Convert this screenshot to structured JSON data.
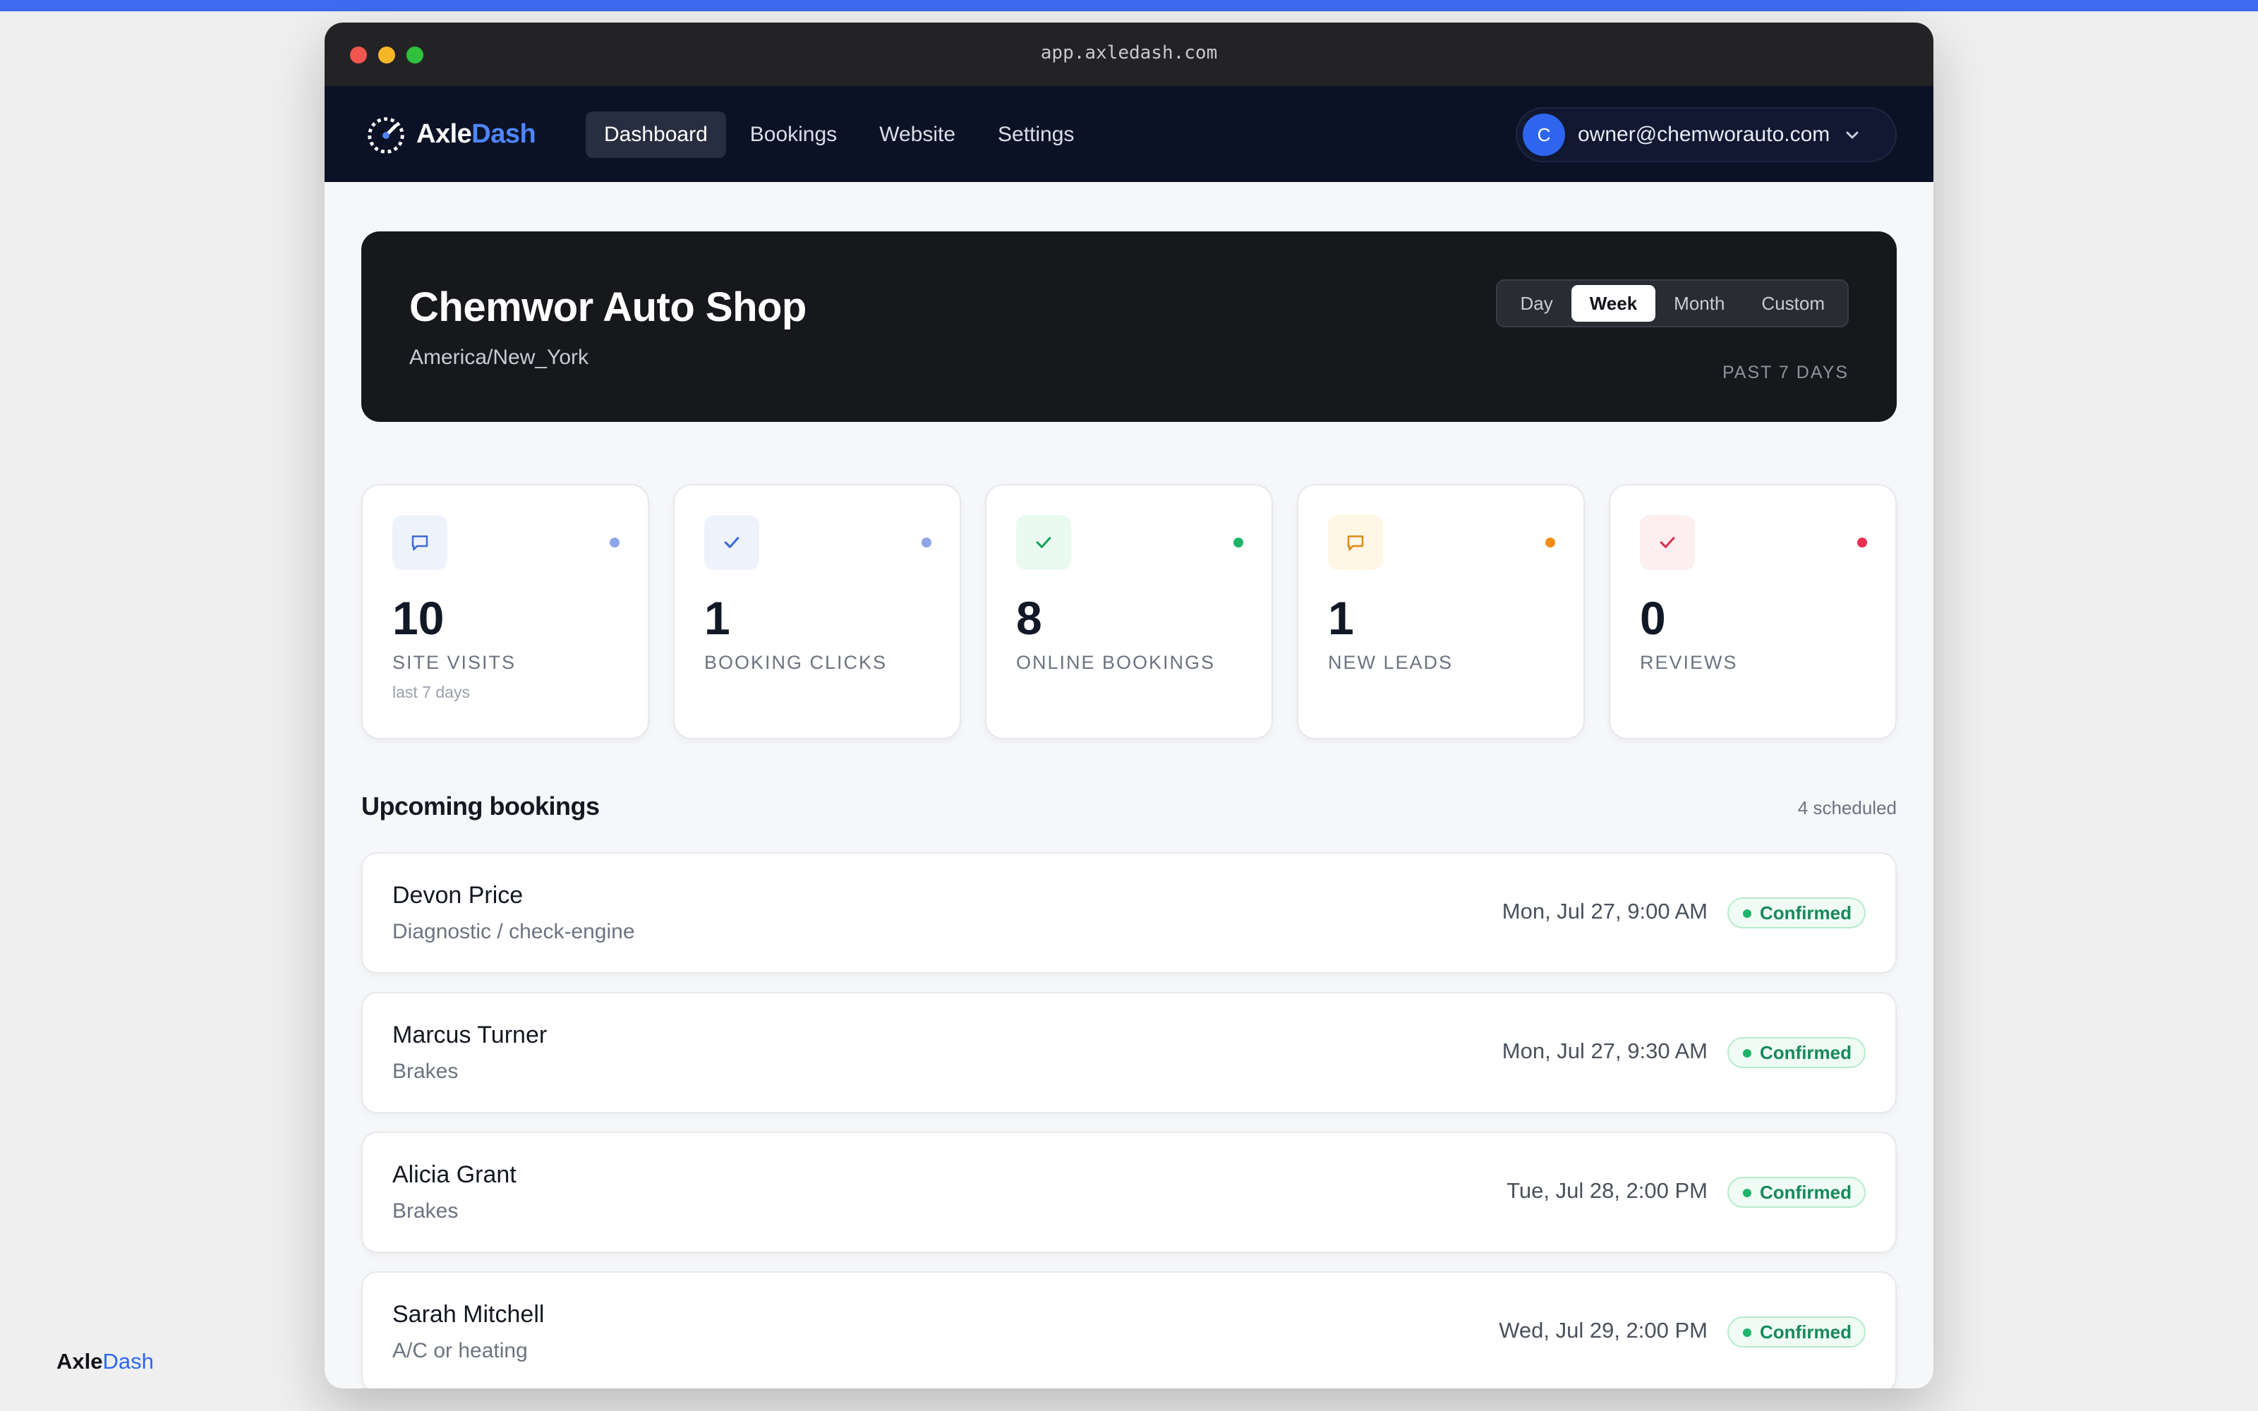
{
  "browser": {
    "url": "app.axledash.com"
  },
  "brand": {
    "name_prefix": "Axle",
    "name_suffix": "Dash"
  },
  "nav": {
    "links": [
      {
        "label": "Dashboard",
        "active": true
      },
      {
        "label": "Bookings"
      },
      {
        "label": "Website"
      },
      {
        "label": "Settings"
      }
    ]
  },
  "account": {
    "initial": "C",
    "email": "owner@chemworauto.com"
  },
  "shop": {
    "name": "Chemwor Auto Shop",
    "timezone": "America/New_York"
  },
  "range": {
    "options": [
      "Day",
      "Week",
      "Month",
      "Custom"
    ],
    "selected": "Week",
    "caption": "PAST 7 DAYS"
  },
  "stats": [
    {
      "value": "10",
      "label": "SITE VISITS",
      "sub": "last 7 days",
      "icon": "chat-icon",
      "color": "#3d6bd6",
      "bg": "#eef2fb",
      "dot": "#8ea5e8"
    },
    {
      "value": "1",
      "label": "BOOKING CLICKS",
      "sub": "",
      "icon": "check-icon",
      "color": "#3d6bd6",
      "bg": "#eef2fb",
      "dot": "#8ea5e8"
    },
    {
      "value": "8",
      "label": "ONLINE BOOKINGS",
      "sub": "",
      "icon": "check-icon",
      "color": "#16a35f",
      "bg": "#eafaf1",
      "dot": "#1fb36c"
    },
    {
      "value": "1",
      "label": "NEW LEADS",
      "sub": "",
      "icon": "chat-icon",
      "color": "#e08a12",
      "bg": "#fff6e5",
      "dot": "#f08d12"
    },
    {
      "value": "0",
      "label": "REVIEWS",
      "sub": "",
      "icon": "check-icon",
      "color": "#d8324f",
      "bg": "#fdeef0",
      "dot": "#e72f4f"
    }
  ],
  "upcoming": {
    "title": "Upcoming bookings",
    "count_label": "4 scheduled",
    "items": [
      {
        "name": "Devon Price",
        "service": "Diagnostic / check-engine",
        "time": "Mon, Jul 27, 9:00 AM",
        "status": "Confirmed"
      },
      {
        "name": "Marcus Turner",
        "service": "Brakes",
        "time": "Mon, Jul 27, 9:30 AM",
        "status": "Confirmed"
      },
      {
        "name": "Alicia Grant",
        "service": "Brakes",
        "time": "Tue, Jul 28, 2:00 PM",
        "status": "Confirmed"
      },
      {
        "name": "Sarah Mitchell",
        "service": "A/C or heating",
        "time": "Wed, Jul 29, 2:00 PM",
        "status": "Confirmed"
      }
    ]
  },
  "footer": {
    "brand_prefix": "Axle",
    "brand_suffix": "Dash"
  }
}
